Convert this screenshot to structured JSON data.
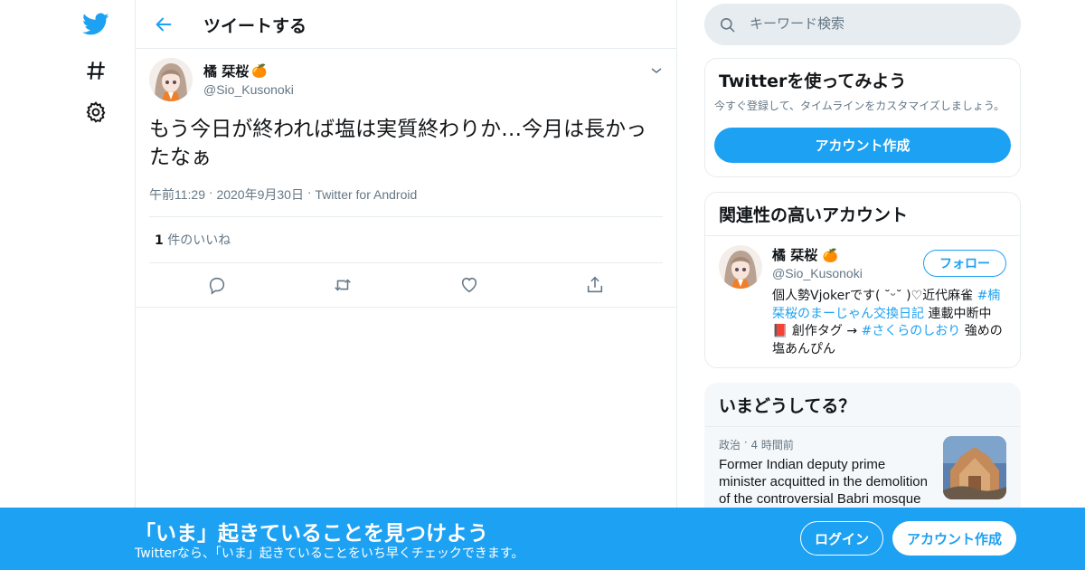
{
  "nav": {
    "logo": "twitter-bird-icon",
    "explore": "hashtag-icon",
    "settings": "gear-icon"
  },
  "header": {
    "back": "back-arrow-icon",
    "title": "ツイートする"
  },
  "tweet": {
    "author_name": "橘 栞桜",
    "author_emoji": "🍊",
    "author_handle": "@Sio_Kusonoki",
    "text": "もう今日が終われば塩は実質終わりか…今月は長かったなぁ",
    "time": "午前11:29",
    "date": "2020年9月30日",
    "source": "Twitter for Android",
    "like_count": "1",
    "like_label": "件のいいね",
    "actions": [
      "reply-icon",
      "retweet-icon",
      "like-icon",
      "share-icon"
    ]
  },
  "search": {
    "placeholder": "キーワード検索"
  },
  "signup_card": {
    "title": "Twitterを使ってみよう",
    "description": "今すぐ登録して、タイムラインをカスタマイズしましょう。",
    "button": "アカウント作成"
  },
  "related": {
    "title": "関連性の高いアカウント",
    "name": "橘 栞桜",
    "emoji": "🍊",
    "handle": "@Sio_Kusonoki",
    "follow": "フォロー",
    "bio": {
      "p1": "個人勢Vjokerです( ˘ᵕ˘ )♡近代麻雀 ",
      "link1": "#楠栞桜のまーじゃん交換日記",
      "p2": " 連載中断中",
      "book": "📕",
      "p3": " 創作タグ → ",
      "link2": "#さくらのしおり",
      "p4": " 強めの塩あんぴん"
    }
  },
  "trends": {
    "title": "いまどうしてる？",
    "item": {
      "category": "政治",
      "time": "4 時間前",
      "text": "Former Indian deputy prime minister acquitted in the demolition of the controversial Babri mosque"
    }
  },
  "bottom": {
    "title": "「いま」起きていることを見つけよう",
    "subtitle": "Twitterなら、「いま」起きていることをいち早くチェックできます。",
    "login": "ログイン",
    "signup": "アカウント作成"
  },
  "colors": {
    "accent": "#1da1f2",
    "text": "#14171a",
    "secondary": "#657786",
    "border": "#e6ecf0"
  }
}
